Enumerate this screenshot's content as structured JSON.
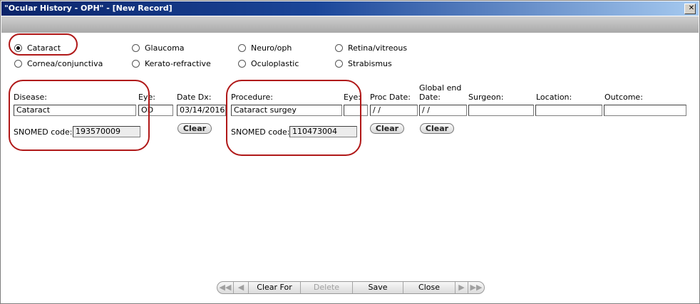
{
  "window": {
    "title": "\"Ocular History - OPH\" - [New Record]",
    "close_glyph": "✕"
  },
  "categories": {
    "items": [
      {
        "label": "Cataract",
        "checked": true
      },
      {
        "label": "Cornea/conjunctiva",
        "checked": false
      },
      {
        "label": "Glaucoma",
        "checked": false
      },
      {
        "label": "Kerato-refractive",
        "checked": false
      },
      {
        "label": "Neuro/oph",
        "checked": false
      },
      {
        "label": "Oculoplastic",
        "checked": false
      },
      {
        "label": "Retina/vitreous",
        "checked": false
      },
      {
        "label": "Strabismus",
        "checked": false
      }
    ]
  },
  "disease": {
    "label": "Disease:",
    "value": "Cataract",
    "eye_label": "Eye:",
    "eye_value": "OD",
    "date_label": "Date Dx:",
    "date_value": "03/14/2016",
    "snomed_label": "SNOMED code:",
    "snomed_value": "193570009",
    "clear_label": "Clear"
  },
  "procedure": {
    "label": "Procedure:",
    "value": "Cataract surgey",
    "eye_label": "Eye:",
    "eye_value": "",
    "proc_date_label": "Proc Date:",
    "proc_date_value": "  /  /",
    "global_end_label_1": "Global end",
    "global_end_label_2": "Date:",
    "global_end_value": "  /  /",
    "surgeon_label": "Surgeon:",
    "surgeon_value": "",
    "location_label": "Location:",
    "location_value": "",
    "outcome_label": "Outcome:",
    "outcome_value": "",
    "snomed_label": "SNOMED code:",
    "snomed_value": "110473004",
    "clear_proc_date_label": "Clear",
    "clear_global_label": "Clear"
  },
  "nav": {
    "first_glyph": "◀◀",
    "prev_glyph": "◀",
    "clear_for_add": "Clear For Add",
    "delete": "Delete",
    "save": "Save",
    "close": "Close",
    "next_glyph": "▶",
    "last_glyph": "▶▶"
  },
  "colors": {
    "highlight_oval": "#b01818",
    "title_bar": "#0a246a"
  }
}
